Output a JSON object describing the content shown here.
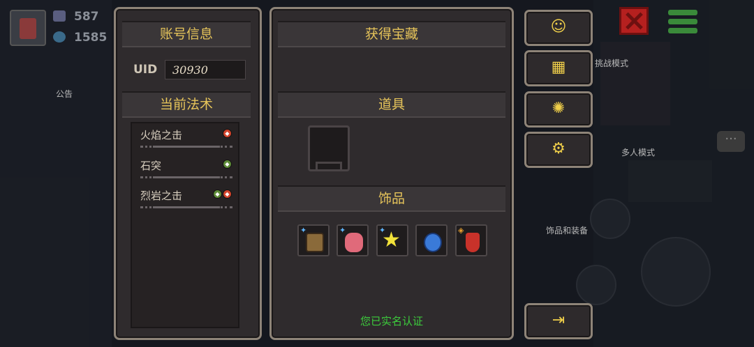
{
  "background": {
    "gems": "587",
    "coins": "1585",
    "label_notice": "公告",
    "label_challenge": "挑战模式",
    "label_multiplayer": "多人模式",
    "label_accessories_gear": "饰品和装备"
  },
  "account_panel": {
    "title": "账号信息",
    "uid_label": "UID",
    "uid_value": "30930",
    "spells_title": "当前法术",
    "spells": [
      {
        "name": "火焰之击",
        "elements": [
          "fire"
        ]
      },
      {
        "name": "石突",
        "elements": [
          "earth"
        ]
      },
      {
        "name": "烈岩之击",
        "elements": [
          "earth",
          "fire"
        ]
      }
    ]
  },
  "treasure_panel": {
    "title": "获得宝藏",
    "items_title": "道具",
    "accessories_title": "饰品",
    "accessories": [
      {
        "icon": "scroll-icon",
        "color": "#8a6a3a"
      },
      {
        "icon": "meat-icon",
        "color": "#e06a7a"
      },
      {
        "icon": "star-icon",
        "color": "#f2e23a"
      },
      {
        "icon": "blue-gem-icon",
        "color": "#3a7ad8"
      },
      {
        "icon": "red-potion-icon",
        "color": "#c8322a"
      }
    ],
    "verified_text": "您已实名认证"
  },
  "side_buttons": [
    "support-icon",
    "gift-icon",
    "bug-icon",
    "settings-icon",
    "logout-icon"
  ]
}
